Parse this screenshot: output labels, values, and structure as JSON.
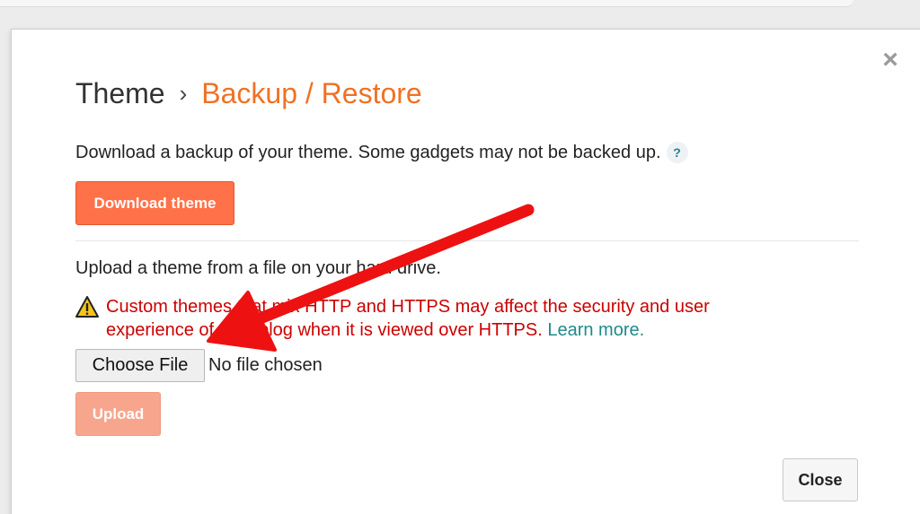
{
  "dialog": {
    "close_glyph": "×",
    "breadcrumb": {
      "parent": "Theme",
      "separator": "›",
      "current": "Backup / Restore"
    },
    "backup": {
      "description": "Download a backup of your theme. Some gadgets may not be backed up.",
      "help_glyph": "?",
      "download_label": "Download theme"
    },
    "upload": {
      "description": "Upload a theme from a file on your hard drive.",
      "warning_text": "Custom themes that mix HTTP and HTTPS may affect the security and user experience of your blog when it is viewed over HTTPS.",
      "learn_more": "Learn more",
      "trailing_period": ".",
      "choose_file_label": "Choose File",
      "no_file_text": "No file chosen",
      "upload_label": "Upload"
    },
    "close_label": "Close"
  },
  "colors": {
    "accent": "#f07125",
    "button_orange": "#ff7148",
    "button_disabled": "#f7a58c",
    "warning_red": "#cc0000",
    "link_teal": "#1f8a8a",
    "annotation_arrow": "#ee1111"
  },
  "icons": {
    "close": "close-icon",
    "help": "help-icon",
    "warning": "warning-triangle-icon",
    "arrow": "annotation-arrow"
  }
}
